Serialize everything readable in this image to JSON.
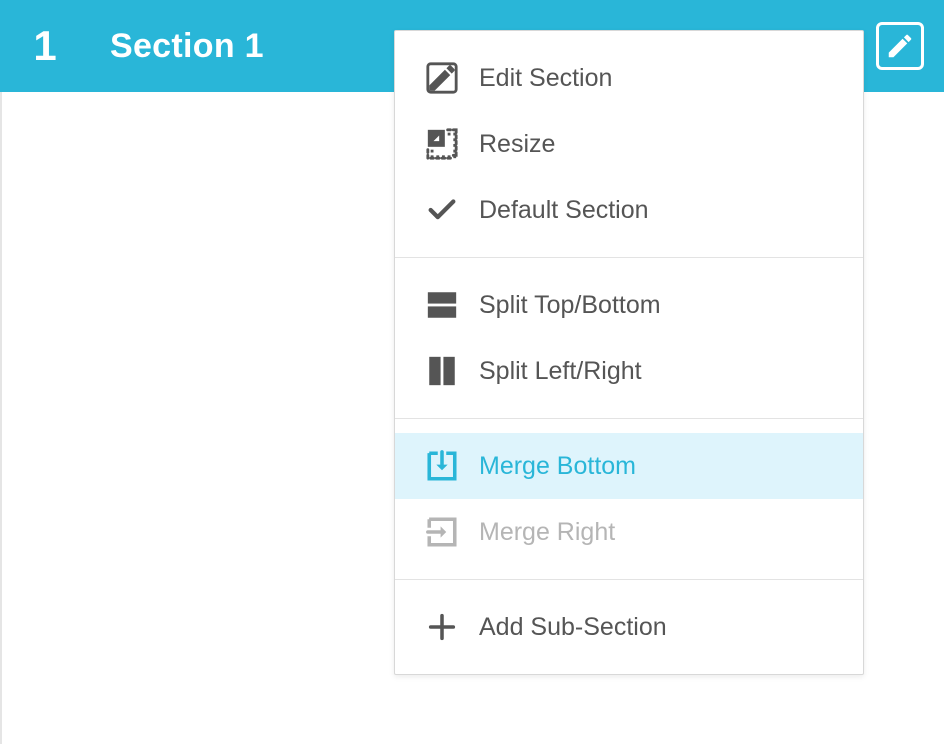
{
  "header": {
    "number": "1",
    "title": "Section 1"
  },
  "menu": {
    "groups": [
      {
        "items": [
          {
            "id": "edit",
            "label": "Edit Section",
            "icon": "edit-icon"
          },
          {
            "id": "resize",
            "label": "Resize",
            "icon": "resize-icon"
          },
          {
            "id": "default",
            "label": "Default Section",
            "icon": "check-icon"
          }
        ]
      },
      {
        "items": [
          {
            "id": "split-tb",
            "label": "Split Top/Bottom",
            "icon": "split-horizontal-icon"
          },
          {
            "id": "split-lr",
            "label": "Split Left/Right",
            "icon": "split-vertical-icon"
          }
        ]
      },
      {
        "items": [
          {
            "id": "merge-bottom",
            "label": "Merge Bottom",
            "icon": "merge-bottom-icon",
            "highlighted": true
          },
          {
            "id": "merge-right",
            "label": "Merge Right",
            "icon": "merge-right-icon",
            "disabled": true
          }
        ]
      },
      {
        "items": [
          {
            "id": "add-sub",
            "label": "Add Sub-Section",
            "icon": "plus-icon"
          }
        ]
      }
    ]
  },
  "colors": {
    "accent": "#29b6d8",
    "highlight_bg": "#def4fc",
    "text": "#555555",
    "disabled": "#b5b5b5"
  }
}
